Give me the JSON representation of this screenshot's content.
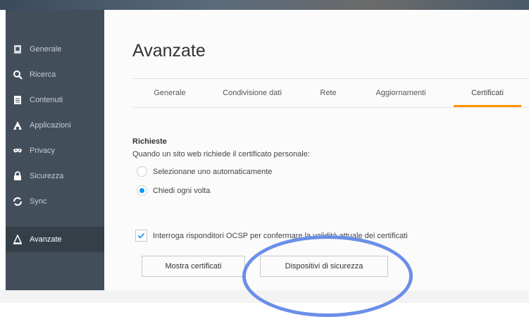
{
  "sidebar": {
    "items": [
      {
        "label": "Generale",
        "icon": "general-icon"
      },
      {
        "label": "Ricerca",
        "icon": "search-icon"
      },
      {
        "label": "Contenuti",
        "icon": "content-icon"
      },
      {
        "label": "Applicazioni",
        "icon": "applications-icon"
      },
      {
        "label": "Privacy",
        "icon": "privacy-mask-icon"
      },
      {
        "label": "Sicurezza",
        "icon": "lock-icon"
      },
      {
        "label": "Sync",
        "icon": "sync-icon"
      },
      {
        "label": "Avanzate",
        "icon": "advanced-icon",
        "active": true
      }
    ]
  },
  "main": {
    "title": "Avanzate",
    "tabs": [
      {
        "label": "Generale"
      },
      {
        "label": "Condivisione dati"
      },
      {
        "label": "Rete"
      },
      {
        "label": "Aggiornamenti"
      },
      {
        "label": "Certificati",
        "active": true
      }
    ],
    "requests": {
      "heading": "Richieste",
      "description": "Quando un sito web richiede il certificato personale:",
      "options": [
        {
          "label": "Selezionane uno automaticamente",
          "checked": false
        },
        {
          "label": "Chiedi ogni volta",
          "checked": true
        }
      ]
    },
    "ocsp": {
      "label": "Interroga risponditori OCSP per confermare la validità attuale dei certificati",
      "checked": true
    },
    "buttons": {
      "show_certificates": "Mostra certificati",
      "security_devices": "Dispositivi di sicurezza"
    }
  },
  "colors": {
    "sidebar_bg": "#424f5a",
    "sidebar_active": "#343f48",
    "accent_tab": "#ff9400",
    "radio_checked": "#0996f8",
    "annotation_ring": "#6b8fe8"
  }
}
